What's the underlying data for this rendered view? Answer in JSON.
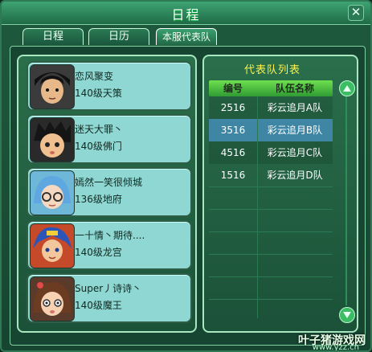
{
  "window": {
    "title": "日程"
  },
  "tabs": [
    {
      "label": "日程"
    },
    {
      "label": "日历"
    },
    {
      "label": "本服代表队"
    }
  ],
  "players": [
    {
      "name": "恋风聚变",
      "level": "140级天策"
    },
    {
      "name": "迷天大罪丶",
      "level": "140级佛门"
    },
    {
      "name": "嫣然一笑很倾城",
      "level": "136级地府"
    },
    {
      "name": "一十情丶期待....",
      "level": "140级龙宫"
    },
    {
      "name": "Super丿诗诗丶",
      "level": "140级魔王"
    }
  ],
  "team_list": {
    "title": "代表队列表",
    "columns": [
      "编号",
      "队伍名称"
    ],
    "rows": [
      {
        "id": "2516",
        "name": "彩云追月A队"
      },
      {
        "id": "3516",
        "name": "彩云追月B队"
      },
      {
        "id": "4516",
        "name": "彩云追月C队"
      },
      {
        "id": "1516",
        "name": "彩云追月D队"
      }
    ],
    "selected_index": 1
  },
  "watermark": {
    "brand": "叶子猪游戏网",
    "url": "www.yzz.cn"
  }
}
